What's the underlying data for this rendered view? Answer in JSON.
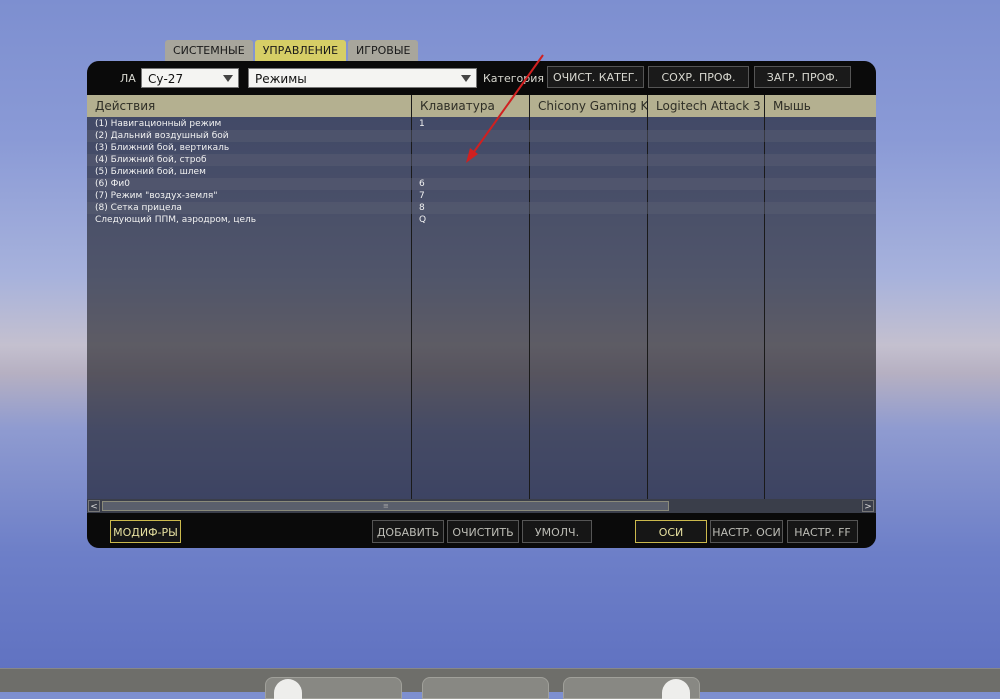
{
  "tabs": [
    "СИСТЕМНЫЕ",
    "УПРАВЛЕНИЕ",
    "ИГРОВЫЕ"
  ],
  "toolbar": {
    "aircraft_label": "ЛА",
    "aircraft_value": "Су-27",
    "category_value": "Режимы",
    "category_label": "Категория",
    "clear_cat": "ОЧИСТ. КАТЕГ.",
    "save_profile": "СОХР. ПРОФ. КАК",
    "load_profile": "ЗАГР. ПРОФ."
  },
  "columns": [
    "Действия",
    "Клавиатура",
    "Chicony Gaming Keyboard",
    "Logitech Attack 3",
    "Мышь"
  ],
  "rows": [
    {
      "action": "(1) Навигационный режим",
      "key": "1"
    },
    {
      "action": "(2) Дальний воздушный бой",
      "key": ""
    },
    {
      "action": "(3) Ближний бой, вертикаль",
      "key": ""
    },
    {
      "action": "(4) Ближний бой, строб",
      "key": ""
    },
    {
      "action": "(5) Ближний бой, шлем",
      "key": ""
    },
    {
      "action": "(6) Фи0",
      "key": "6"
    },
    {
      "action": "(7) Режим \"воздух-земля\"",
      "key": "7"
    },
    {
      "action": "(8) Сетка прицела",
      "key": "8"
    },
    {
      "action": "Следующий ППМ, аэродром, цель",
      "key": "Q"
    }
  ],
  "bottom": {
    "modifiers": "МОДИФ-РЫ",
    "add": "ДОБАВИТЬ",
    "clear": "ОЧИСТИТЬ",
    "default": "УМОЛЧ.",
    "axes": "ОСИ",
    "axis_setup": "НАСТР. ОСИ",
    "ff_setup": "НАСТР. FF"
  },
  "scrollbar": {
    "left": "<",
    "right": ">",
    "grip": "≡"
  },
  "colors": {
    "accent": "#d6ce66",
    "header": "#b4b090",
    "annotation": "#d02020"
  }
}
